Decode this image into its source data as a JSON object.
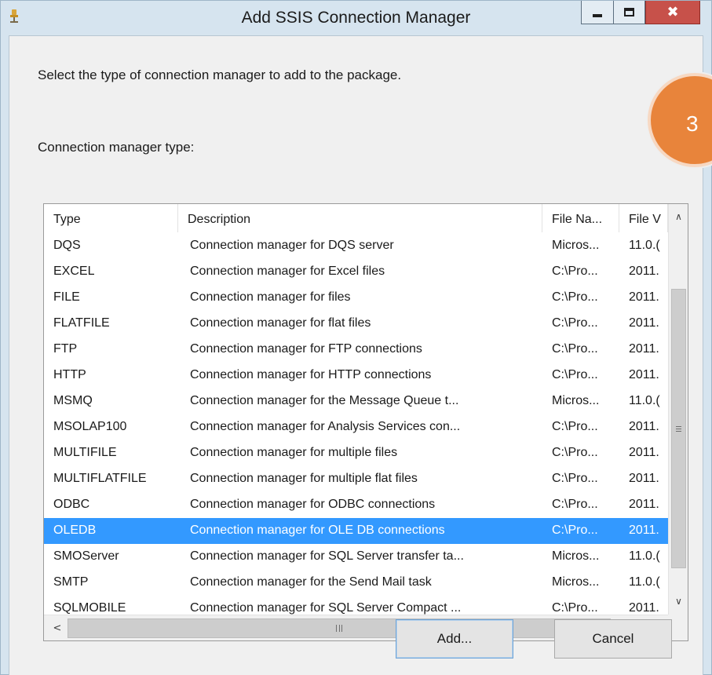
{
  "window": {
    "title": "Add SSIS Connection Manager",
    "icon": "ssis-app-icon",
    "controls": {
      "minimize": "minimize-icon",
      "maximize": "maximize-icon",
      "close": "close-icon",
      "close_glyph": "✖"
    }
  },
  "prompt": "Select the type of connection manager to add to the package.",
  "step_badge": "3",
  "list": {
    "label": "Connection manager type:",
    "columns": [
      "Type",
      "Description",
      "File Na...",
      "File V"
    ],
    "rows": [
      {
        "type": "DQS",
        "description": "Connection manager for DQS server",
        "file_name": "Micros...",
        "file_version": "11.0.("
      },
      {
        "type": "EXCEL",
        "description": "Connection manager for Excel files",
        "file_name": "C:\\Pro...",
        "file_version": "2011."
      },
      {
        "type": "FILE",
        "description": "Connection manager for files",
        "file_name": "C:\\Pro...",
        "file_version": "2011."
      },
      {
        "type": "FLATFILE",
        "description": "Connection manager for flat files",
        "file_name": "C:\\Pro...",
        "file_version": "2011."
      },
      {
        "type": "FTP",
        "description": "Connection manager for FTP connections",
        "file_name": "C:\\Pro...",
        "file_version": "2011."
      },
      {
        "type": "HTTP",
        "description": "Connection manager for HTTP connections",
        "file_name": "C:\\Pro...",
        "file_version": "2011."
      },
      {
        "type": "MSMQ",
        "description": "Connection manager for the Message Queue t...",
        "file_name": "Micros...",
        "file_version": "11.0.("
      },
      {
        "type": "MSOLAP100",
        "description": "Connection manager for Analysis Services con...",
        "file_name": "C:\\Pro...",
        "file_version": "2011."
      },
      {
        "type": "MULTIFILE",
        "description": "Connection manager for multiple files",
        "file_name": "C:\\Pro...",
        "file_version": "2011."
      },
      {
        "type": "MULTIFLATFILE",
        "description": "Connection manager for multiple flat files",
        "file_name": "C:\\Pro...",
        "file_version": "2011."
      },
      {
        "type": "ODBC",
        "description": "Connection manager for ODBC connections",
        "file_name": "C:\\Pro...",
        "file_version": "2011."
      },
      {
        "type": "OLEDB",
        "description": "Connection manager for OLE DB connections",
        "file_name": "C:\\Pro...",
        "file_version": "2011.",
        "selected": true
      },
      {
        "type": "SMOServer",
        "description": "Connection manager for SQL Server transfer ta...",
        "file_name": "Micros...",
        "file_version": "11.0.("
      },
      {
        "type": "SMTP",
        "description": "Connection manager for the Send Mail task",
        "file_name": "Micros...",
        "file_version": "11.0.("
      },
      {
        "type": "SQLMOBILE",
        "description": "Connection manager for SQL Server Compact ...",
        "file_name": "C:\\Pro...",
        "file_version": "2011."
      }
    ],
    "selected_color": "#3399ff",
    "scroll_glyphs": {
      "up": "∧",
      "down": "∨",
      "left": "<",
      "right": ">"
    }
  },
  "buttons": {
    "add": "Add...",
    "cancel": "Cancel"
  },
  "colors": {
    "titlebar": "#d6e4ef",
    "close_button": "#c7514a",
    "badge": "#e8843b"
  }
}
